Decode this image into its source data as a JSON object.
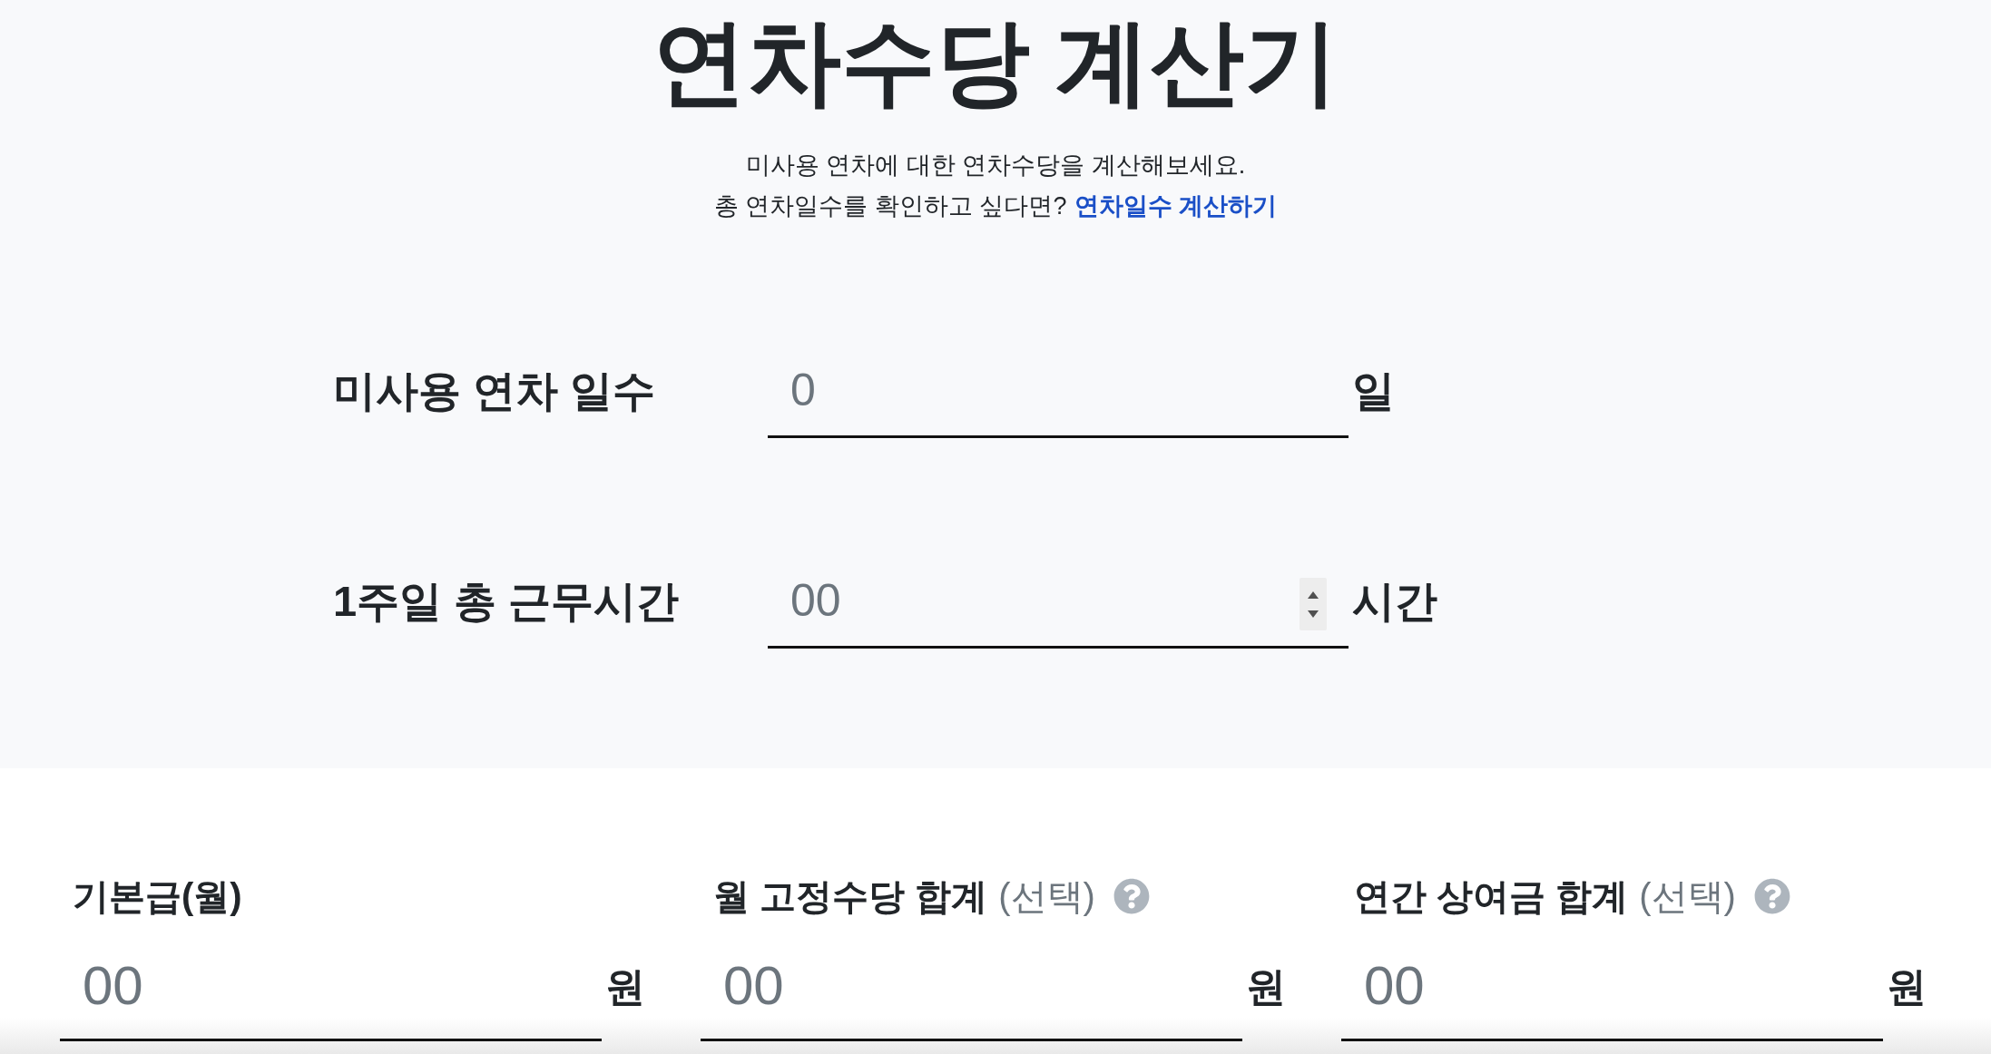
{
  "header": {
    "title": "연차수당 계산기",
    "intro": "미사용 연차에 대한 연차수당을 계산해보세요.",
    "prompt": "총 연차일수를 확인하고 싶다면?",
    "link": "연차일수 계산하기"
  },
  "work_fields": [
    {
      "label": "미사용 연차 일수",
      "placeholder": "0",
      "unit": "일",
      "spinner": false
    },
    {
      "label": "1주일 총 근무시간",
      "placeholder": "00",
      "unit": "시간",
      "spinner": true
    }
  ],
  "pay_fields": [
    {
      "label": "기본급(월)",
      "placeholder": "00",
      "unit": "원",
      "help": false
    },
    {
      "label": "월 고정수당 합계",
      "optional": "(선택)",
      "placeholder": "00",
      "unit": "원",
      "help": true
    },
    {
      "label": "연간 상여금 합계",
      "optional": "(선택)",
      "placeholder": "00",
      "unit": "원",
      "help": true
    }
  ]
}
